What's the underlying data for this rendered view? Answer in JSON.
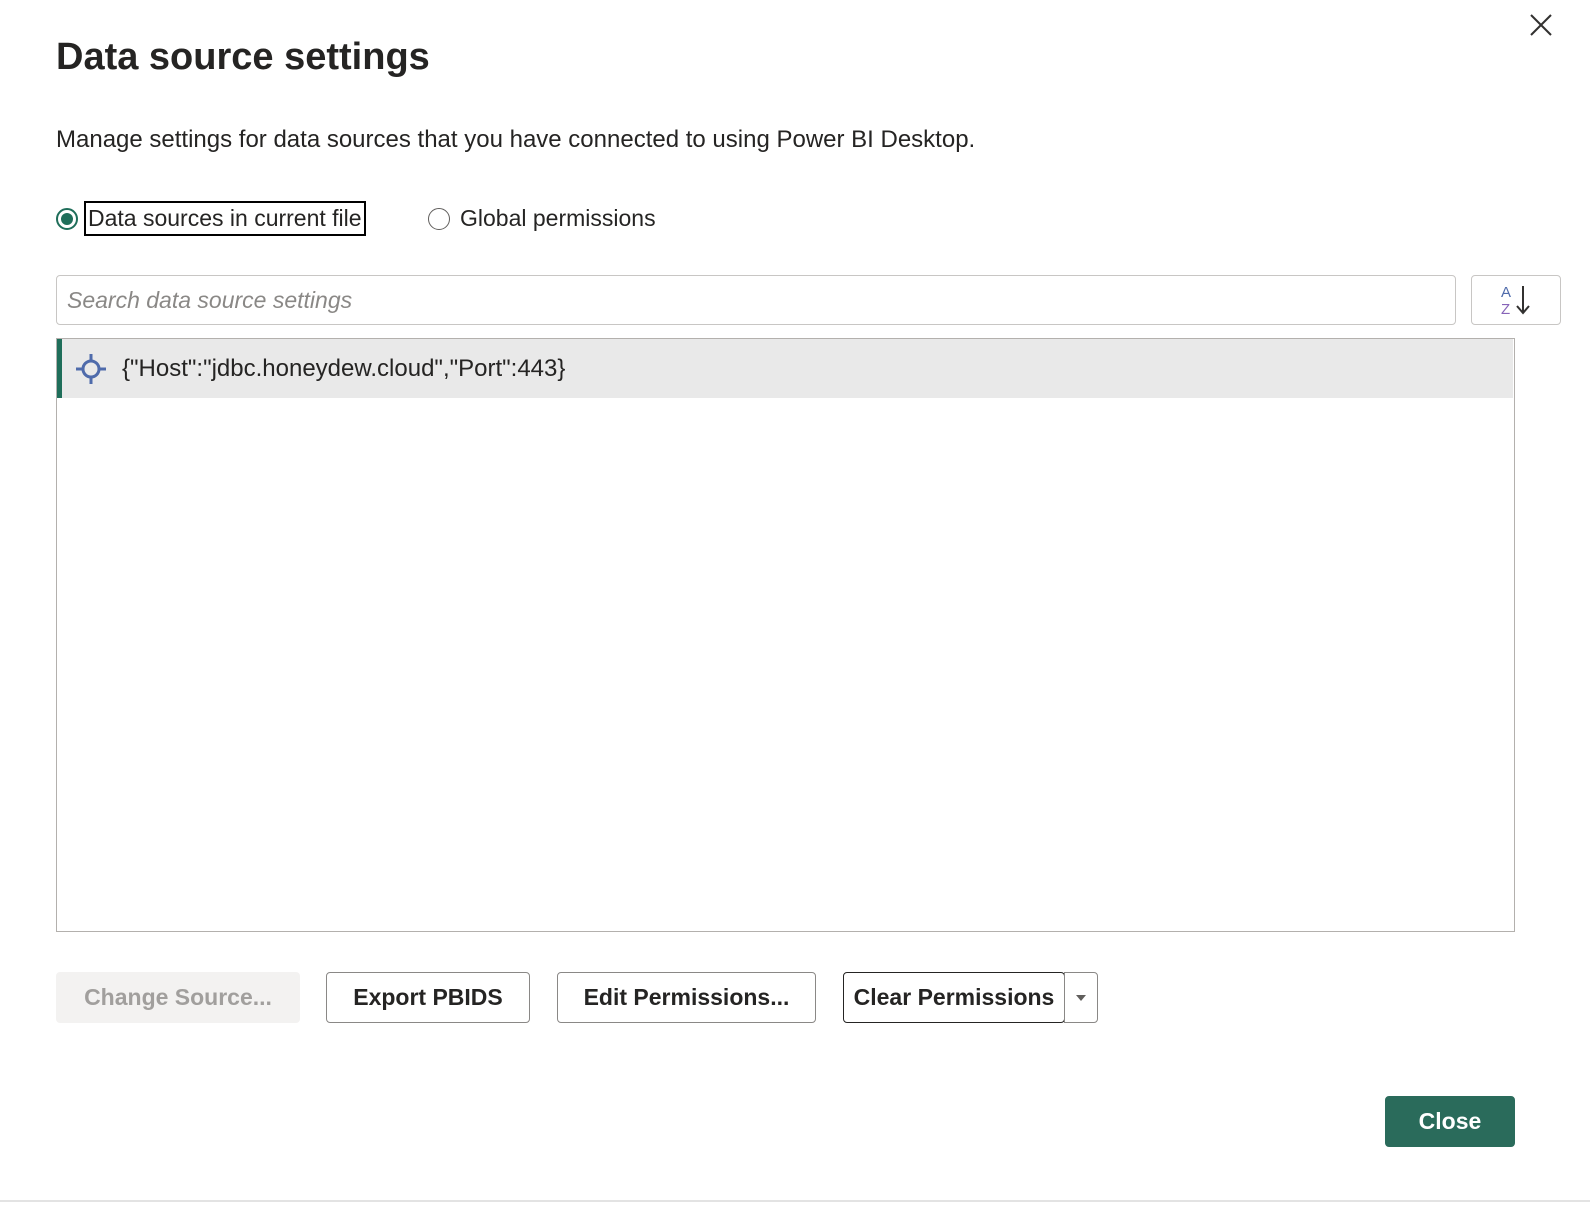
{
  "dialog": {
    "title": "Data source settings",
    "description": "Manage settings for data sources that you have connected to using Power BI Desktop.",
    "close_icon": "close-icon"
  },
  "scope": {
    "options": [
      {
        "label": "Data sources in current file",
        "selected": true
      },
      {
        "label": "Global permissions",
        "selected": false
      }
    ]
  },
  "search": {
    "placeholder": "Search data source settings",
    "value": ""
  },
  "sort": {
    "icon": "sort-az-icon"
  },
  "sources": {
    "items": [
      {
        "label": "{\"Host\":\"jdbc.honeydew.cloud\",\"Port\":443}",
        "icon": "crosshair-icon",
        "selected": true
      }
    ]
  },
  "actions": {
    "change_source": "Change Source...",
    "export_pbids": "Export PBIDS",
    "edit_permissions": "Edit Permissions...",
    "clear_permissions": "Clear Permissions",
    "close": "Close"
  },
  "colors": {
    "accent": "#1f6e5a",
    "primary_button": "#2a6b5b",
    "selected_row": "#e9e9e9",
    "icon_blue": "#4f6bab"
  }
}
